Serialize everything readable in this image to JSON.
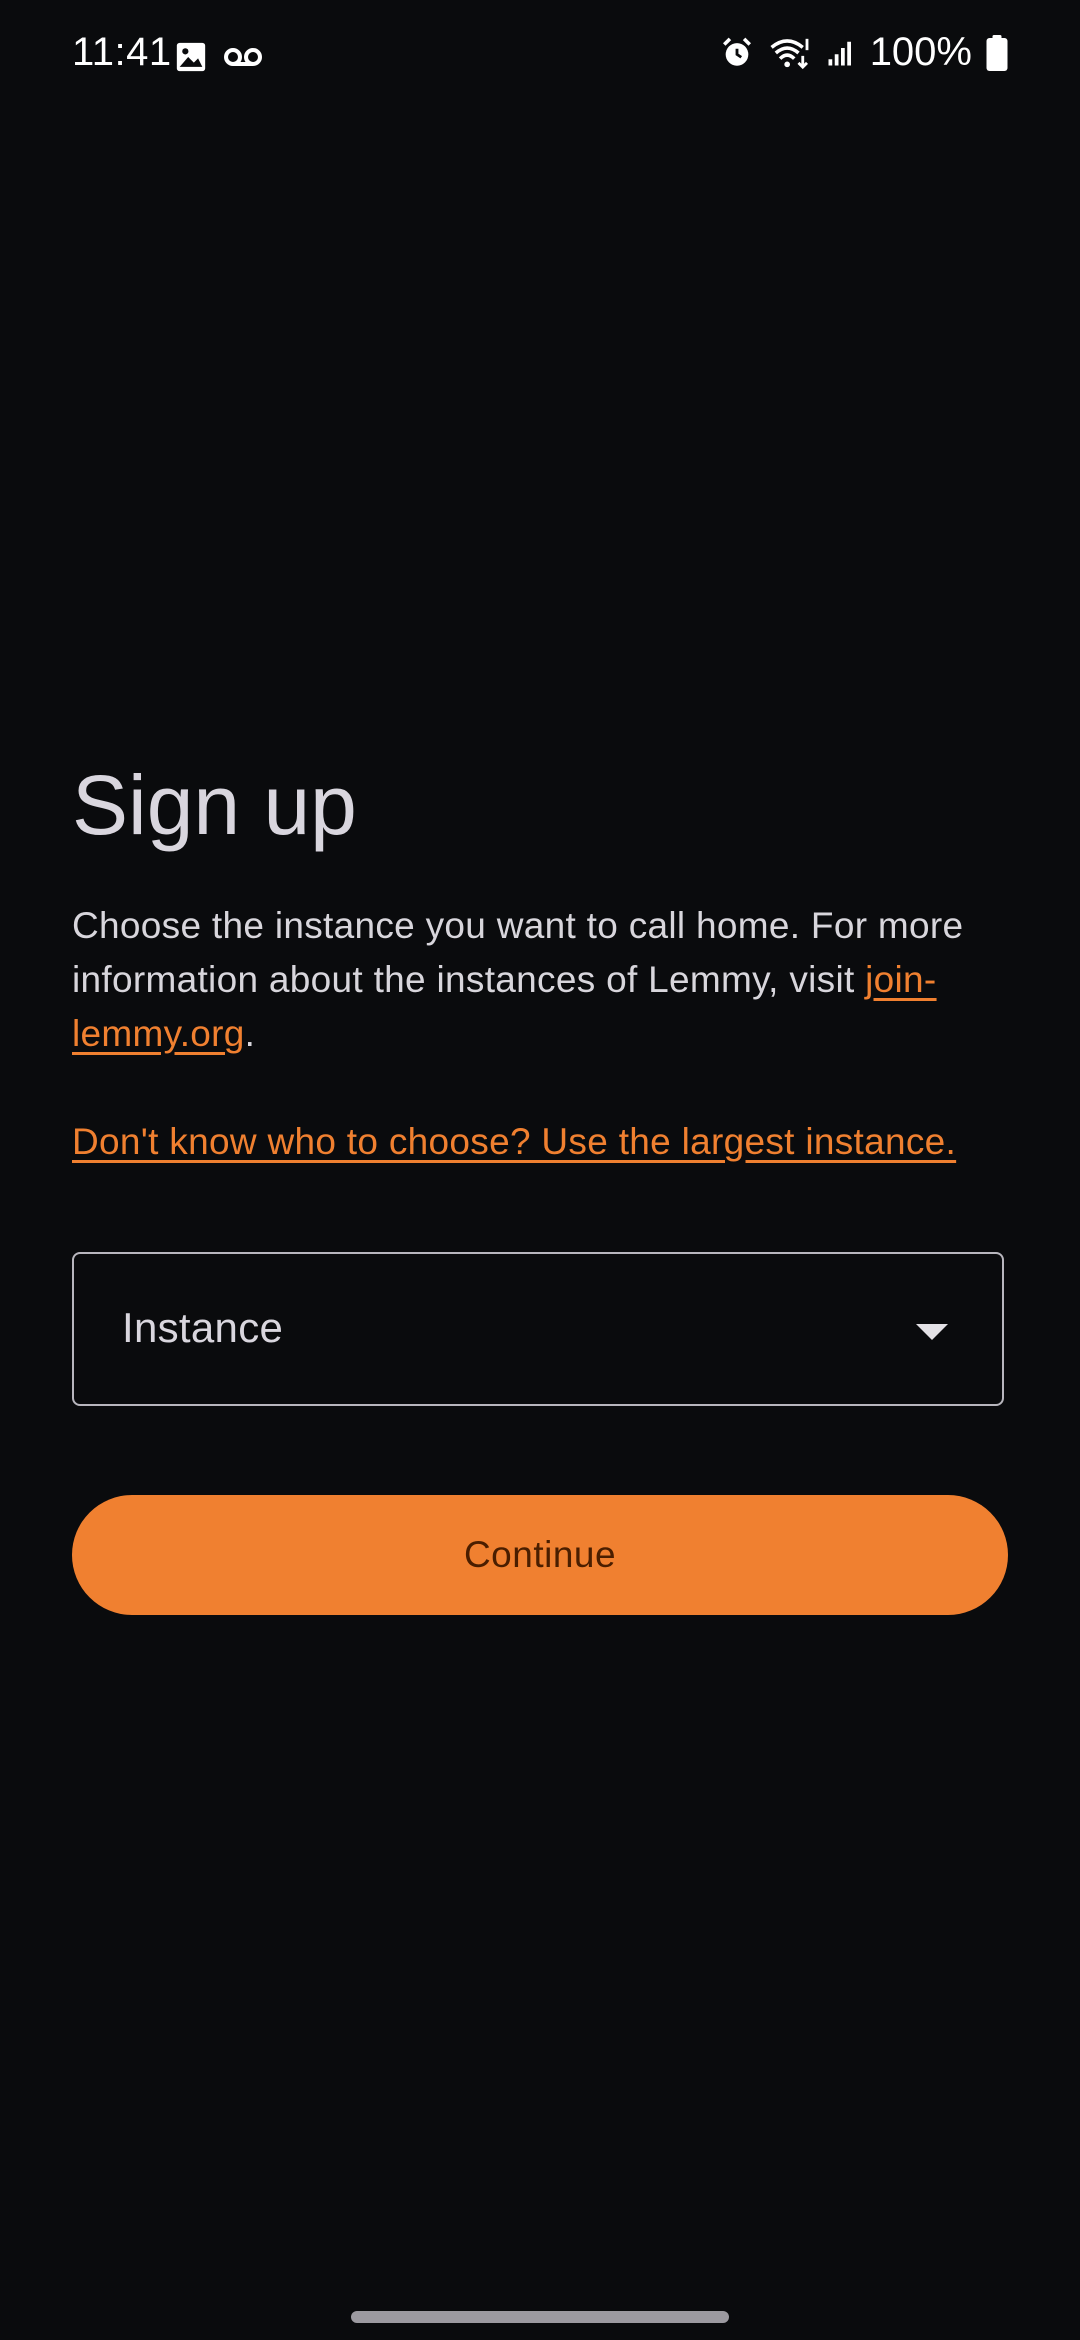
{
  "status_bar": {
    "time": "11:41",
    "battery": "100%",
    "left_icons": [
      "image-icon",
      "voicemail-icon"
    ],
    "right_icons": [
      "alarm-icon",
      "wifi-icon",
      "signal-icon",
      "battery-icon"
    ]
  },
  "signup": {
    "title": "Sign up",
    "description_text": "Choose the instance you want to call home. For more information about the instances of Lemmy, visit ",
    "description_link": "join-lemmy.org",
    "description_suffix": ".",
    "largest_instance_link": "Don't know who to choose? Use the largest instance.",
    "instance_field_label": "Instance",
    "continue_label": "Continue"
  },
  "colors": {
    "background": "#0a0b0d",
    "accent": "#f08030",
    "text": "#d9d6de",
    "button_text": "#4a1e00"
  }
}
